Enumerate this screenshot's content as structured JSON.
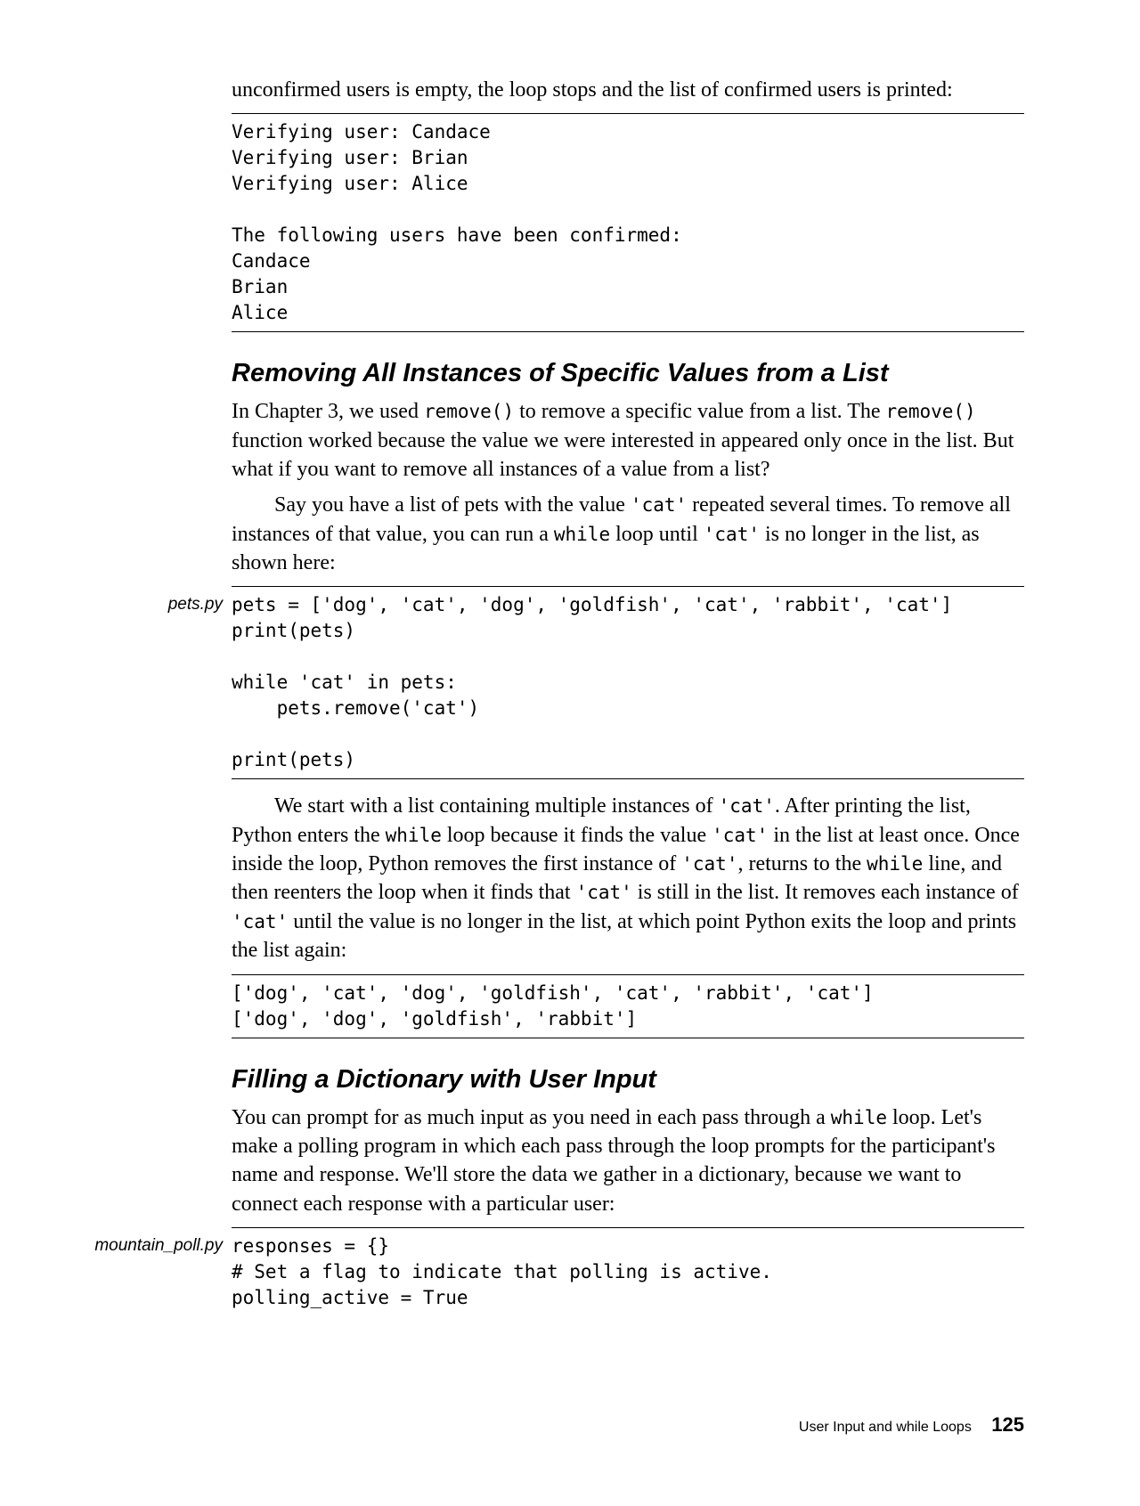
{
  "intro": {
    "p1": "unconfirmed users is empty, the loop stops and the list of confirmed users is printed:"
  },
  "code1": "Verifying user: Candace\nVerifying user: Brian\nVerifying user: Alice\n\nThe following users have been confirmed:\nCandace\nBrian\nAlice",
  "section1": {
    "heading": "Removing All Instances of Specific Values from a List",
    "p1a": "In Chapter 3, we used ",
    "p1b": "remove()",
    "p1c": " to remove a specific value from a list. The ",
    "p1d": "remove()",
    "p1e": " function worked because the value we were interested in appeared only once in the list. But what if you want to remove all instances of a value from a list?",
    "p2a": "Say you have a list of pets with the value ",
    "p2b": "'cat'",
    "p2c": " repeated several times. To remove all instances of that value, you can run a ",
    "p2d": "while",
    "p2e": " loop until ",
    "p2f": "'cat'",
    "p2g": " is no longer in the list, as shown here:"
  },
  "file1": "pets.py",
  "code2": "pets = ['dog', 'cat', 'dog', 'goldfish', 'cat', 'rabbit', 'cat']\nprint(pets)\n\nwhile 'cat' in pets:\n    pets.remove('cat')\n\nprint(pets)",
  "section1b": {
    "p1a": "We start with a list containing multiple instances of ",
    "p1b": "'cat'",
    "p1c": ". After printing the list, Python enters the ",
    "p1d": "while",
    "p1e": " loop because it finds the value ",
    "p1f": "'cat'",
    "p1g": " in the list at least once. Once inside the loop, Python removes the first instance of ",
    "p1h": "'cat'",
    "p1i": ", returns to the ",
    "p1j": "while",
    "p1k": " line, and then reenters the loop when it finds that ",
    "p1l": "'cat'",
    "p1m": " is still in the list. It removes each instance of ",
    "p1n": "'cat'",
    "p1o": " until the value is no longer in the list, at which point Python exits the loop and prints the list again:"
  },
  "code3": "['dog', 'cat', 'dog', 'goldfish', 'cat', 'rabbit', 'cat']\n['dog', 'dog', 'goldfish', 'rabbit']",
  "section2": {
    "heading": "Filling a Dictionary with User Input",
    "p1a": "You can prompt for as much input as you need in each pass through a ",
    "p1b": "while",
    "p1c": " loop. Let's make a polling program in which each pass through the loop prompts for the participant's name and response. We'll store the data we gather in a dictionary, because we want to connect each response with a particular user:"
  },
  "file2": "mountain_poll.py",
  "code4": "responses = {}\n# Set a flag to indicate that polling is active.\npolling_active = True",
  "footer": {
    "chapter": "User Input and while Loops",
    "page": "125"
  }
}
